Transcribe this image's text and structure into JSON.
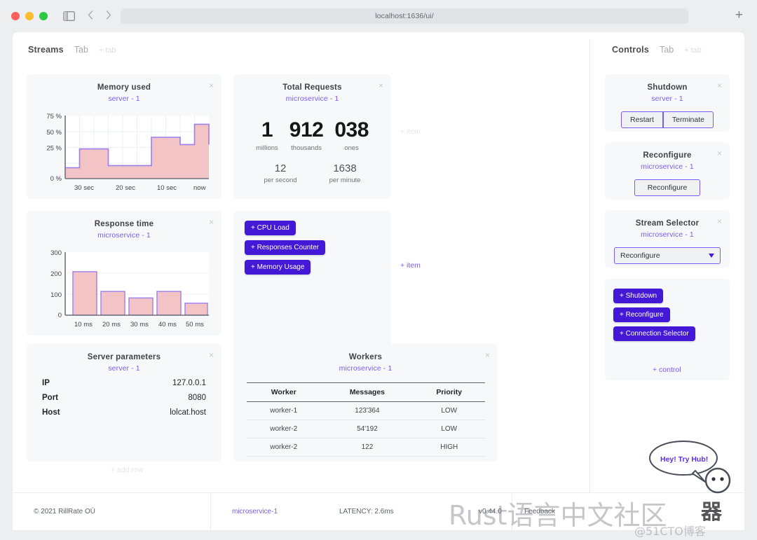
{
  "browser": {
    "url": "localhost:1636/ui/",
    "new_tab_label": "+",
    "back_icon": "chevron-left-icon",
    "forward_icon": "chevron-right-icon",
    "sidebar_icon": "sidebar-toggle-icon"
  },
  "left_pane": {
    "title": "Streams",
    "tab_label": "Tab",
    "add_tab_label": "+ tab",
    "add_item_placeholder": "+ item",
    "add_item_accent": "+ item",
    "add_row_label": "+ add row"
  },
  "right_pane": {
    "title": "Controls",
    "tab_label": "Tab",
    "add_tab_label": "+ tab",
    "add_control_label": "+ control"
  },
  "memory_card": {
    "title": "Memory used",
    "subtitle": "server - 1",
    "close": "×"
  },
  "response_card": {
    "title": "Response time",
    "subtitle": "microservice - 1",
    "close": "×"
  },
  "requests_card": {
    "title": "Total Requests",
    "subtitle": "microservice - 1",
    "close": "×",
    "groups": [
      {
        "value": "1",
        "caption": "millions"
      },
      {
        "value": "912",
        "caption": "thousands"
      },
      {
        "value": "038",
        "caption": "ones"
      }
    ],
    "rates": [
      {
        "value": "12",
        "caption": "per second"
      },
      {
        "value": "1638",
        "caption": "per minute"
      }
    ]
  },
  "stream_buttons_card": {
    "buttons": [
      "+ CPU Load",
      "+ Responses Counter",
      "+ Memory Usage"
    ]
  },
  "server_card": {
    "title": "Server parameters",
    "subtitle": "server - 1",
    "close": "×",
    "rows": [
      {
        "key": "IP",
        "value": "127.0.0.1"
      },
      {
        "key": "Port",
        "value": "8080"
      },
      {
        "key": "Host",
        "value": "lolcat.host"
      }
    ]
  },
  "workers_card": {
    "title": "Workers",
    "subtitle": "microservice - 1",
    "close": "×",
    "columns": [
      "Worker",
      "Messages",
      "Priority"
    ],
    "rows": [
      [
        "worker-1",
        "123'364",
        "LOW"
      ],
      [
        "worker-2",
        "54'192",
        "LOW"
      ],
      [
        "worker-2",
        "122",
        "HIGH"
      ]
    ]
  },
  "shutdown_card": {
    "title": "Shutdown",
    "subtitle": "server - 1",
    "close": "×",
    "restart_label": "Restart",
    "terminate_label": "Terminate"
  },
  "reconfigure_card": {
    "title": "Reconfigure",
    "subtitle": "microservice - 1",
    "close": "×",
    "button_label": "Reconfigure"
  },
  "stream_selector_card": {
    "title": "Stream Selector",
    "subtitle": "microservice - 1",
    "close": "×",
    "selected": "Reconfigure"
  },
  "control_buttons_card": {
    "buttons": [
      "+ Shutdown",
      "+ Reconfigure",
      "+ Connection Selector"
    ]
  },
  "footer": {
    "copyright": "© 2021 RillRate OÜ",
    "service": "microservice-1",
    "latency": "LATENCY: 2.6ms",
    "version": "v0.44.0",
    "feedback": "Feedback"
  },
  "hub_bubble": {
    "text": "Hey! Try Hub!"
  },
  "watermark": {
    "main": "Rust语言中文社区",
    "sub": "@51CTO博客",
    "logo": "器"
  },
  "colors": {
    "accent_purple": "#7b5cf0",
    "button_purple": "#4318d6",
    "chart_fill": "#f2c4c6",
    "chart_stroke": "#9b7ef0",
    "card_bg": "#f7f8fa"
  },
  "chart_data": [
    {
      "type": "area",
      "id": "memory-used",
      "title": "Memory used",
      "subtitle": "server - 1",
      "xlabel": "",
      "ylabel": "",
      "ylim": [
        0,
        87
      ],
      "yticks": [
        "0 %",
        "25 %",
        "50 %",
        "75 %"
      ],
      "ytick_values": [
        0,
        25,
        50,
        75
      ],
      "xticks": [
        "30 sec",
        "20 sec",
        "10 sec",
        "now"
      ],
      "grid": true,
      "step": true,
      "x": [
        0,
        1,
        2,
        3,
        4,
        5,
        6,
        7,
        8,
        9
      ],
      "values": [
        15,
        41,
        41,
        18,
        18,
        57,
        57,
        47,
        75,
        57
      ]
    },
    {
      "type": "bar",
      "id": "response-time",
      "title": "Response time",
      "subtitle": "microservice - 1",
      "xlabel": "",
      "ylabel": "",
      "ylim": [
        0,
        300
      ],
      "yticks": [
        "0",
        "100",
        "200",
        "300"
      ],
      "ytick_values": [
        0,
        100,
        200,
        300
      ],
      "categories": [
        "10 ms",
        "20 ms",
        "30 ms",
        "40 ms",
        "50 ms"
      ],
      "values": [
        207,
        113,
        82,
        113,
        57
      ],
      "grid": true
    }
  ]
}
